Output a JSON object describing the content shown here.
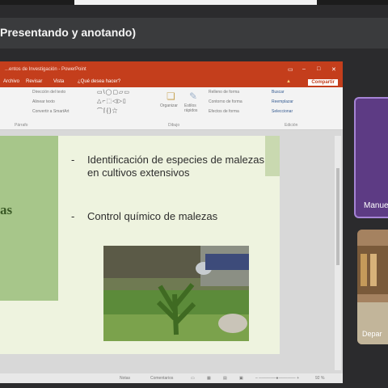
{
  "meeting": {
    "title": "Presentando y anotando)"
  },
  "powerpoint": {
    "window_title": "...entos de Investigación - PowerPoint",
    "tabs": [
      "Archivo",
      "Revisar",
      "Vista",
      "¿Qué desea hacer?"
    ],
    "share_label": "Compartir",
    "ribbon": {
      "groups": [
        "Párrafo",
        "Dibujo",
        "Edición"
      ],
      "paragraph_buttons": [
        "Dirección del texto",
        "Alinear texto",
        "Convertir a SmartArt"
      ],
      "drawing_buttons": [
        "Organizar",
        "Estilos rápidos"
      ],
      "shape_buttons": [
        "Relleno de forma",
        "Contorno de forma",
        "Efectos de forma"
      ],
      "editing_buttons": [
        "Buscar",
        "Reemplazar",
        "Seleccionar"
      ]
    },
    "status": {
      "notes": "Notas",
      "comments": "Comentarios",
      "zoom": "92 %"
    }
  },
  "slide": {
    "left_text": "as",
    "bullets": [
      "Identificación de especies de malezas en cultivos extensivos",
      "Control químico de malezas"
    ]
  },
  "participants": [
    {
      "name": "Manue"
    },
    {
      "name": "Depar"
    }
  ],
  "colors": {
    "powerpoint_red": "#c43e1c",
    "slide_green": "#a7c68a",
    "tile_purple": "#5d3b84"
  }
}
